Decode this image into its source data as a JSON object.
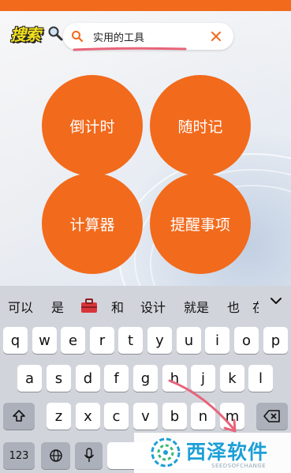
{
  "header": {
    "logo_text": "搜索",
    "search": {
      "value": "实用的工具"
    }
  },
  "tiles": [
    {
      "label": "倒计时"
    },
    {
      "label": "随时记"
    },
    {
      "label": "计算器"
    },
    {
      "label": "提醒事项"
    }
  ],
  "keyboard": {
    "suggestions": [
      "可以",
      "是",
      "和",
      "设计",
      "就是",
      "也",
      "在"
    ],
    "row1": [
      "q",
      "w",
      "e",
      "r",
      "t",
      "y",
      "u",
      "i",
      "o",
      "p"
    ],
    "row2": [
      "a",
      "s",
      "d",
      "f",
      "g",
      "h",
      "j",
      "k",
      "l"
    ],
    "row3": [
      "z",
      "x",
      "c",
      "v",
      "b",
      "n",
      "m"
    ],
    "bottom": {
      "num_label": "123"
    }
  },
  "watermark": {
    "title": "西泽软件",
    "subtitle": "SEEDSOFCHANGE"
  },
  "colors": {
    "accent": "#f26a1c",
    "underline": "#e8647a",
    "watermark_blue": "#1c9fd6",
    "keyboard_bg": "#d1d4db"
  }
}
